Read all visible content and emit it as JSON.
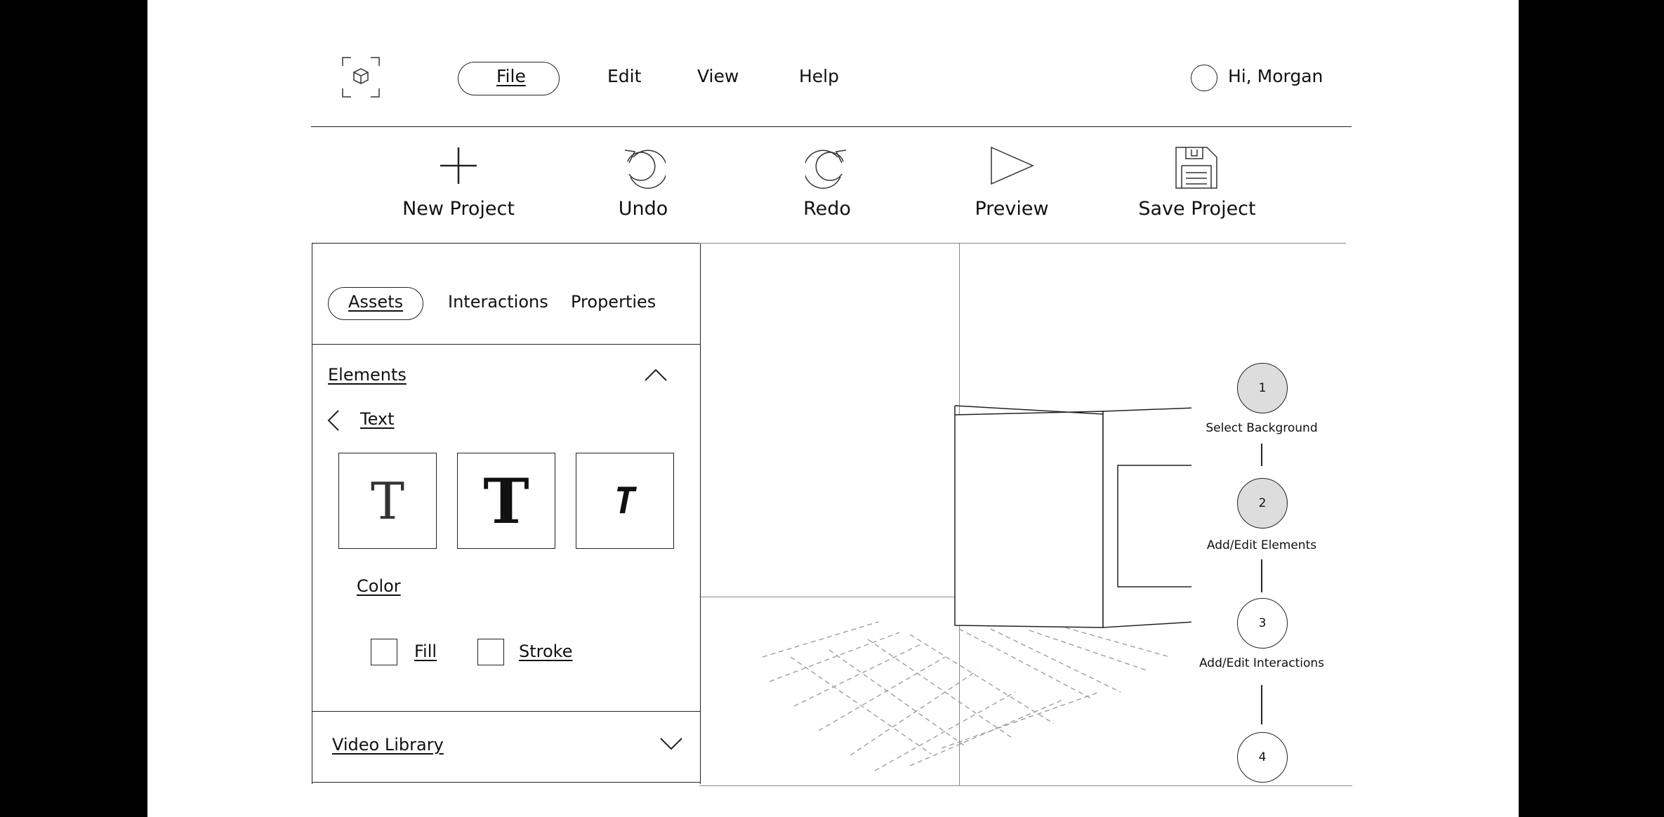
{
  "menu": {
    "logo_icon": "cube-icon",
    "items": [
      "File",
      "Edit",
      "View",
      "Help"
    ],
    "active": "File",
    "greeting": "Hi, Morgan"
  },
  "toolbar": {
    "new_project": "New Project",
    "undo": "Undo",
    "redo": "Redo",
    "preview": "Preview",
    "save_project": "Save Project"
  },
  "panel": {
    "tabs": [
      "Assets",
      "Interactions",
      "Properties"
    ],
    "active_tab": "Assets",
    "elements_header": "Elements",
    "text_section": "Text",
    "text_styles": [
      "T",
      "T",
      "T"
    ],
    "color_label": "Color",
    "fill_label": "Fill",
    "stroke_label": "Stroke",
    "video_library": "Video Library"
  },
  "steps": [
    {
      "number": "1",
      "label": "Select Background",
      "completed": true
    },
    {
      "number": "2",
      "label": "Add/Edit Elements",
      "completed": true
    },
    {
      "number": "3",
      "label": "Add/Edit Interactions",
      "completed": false
    },
    {
      "number": "4",
      "label": "",
      "completed": false
    }
  ]
}
